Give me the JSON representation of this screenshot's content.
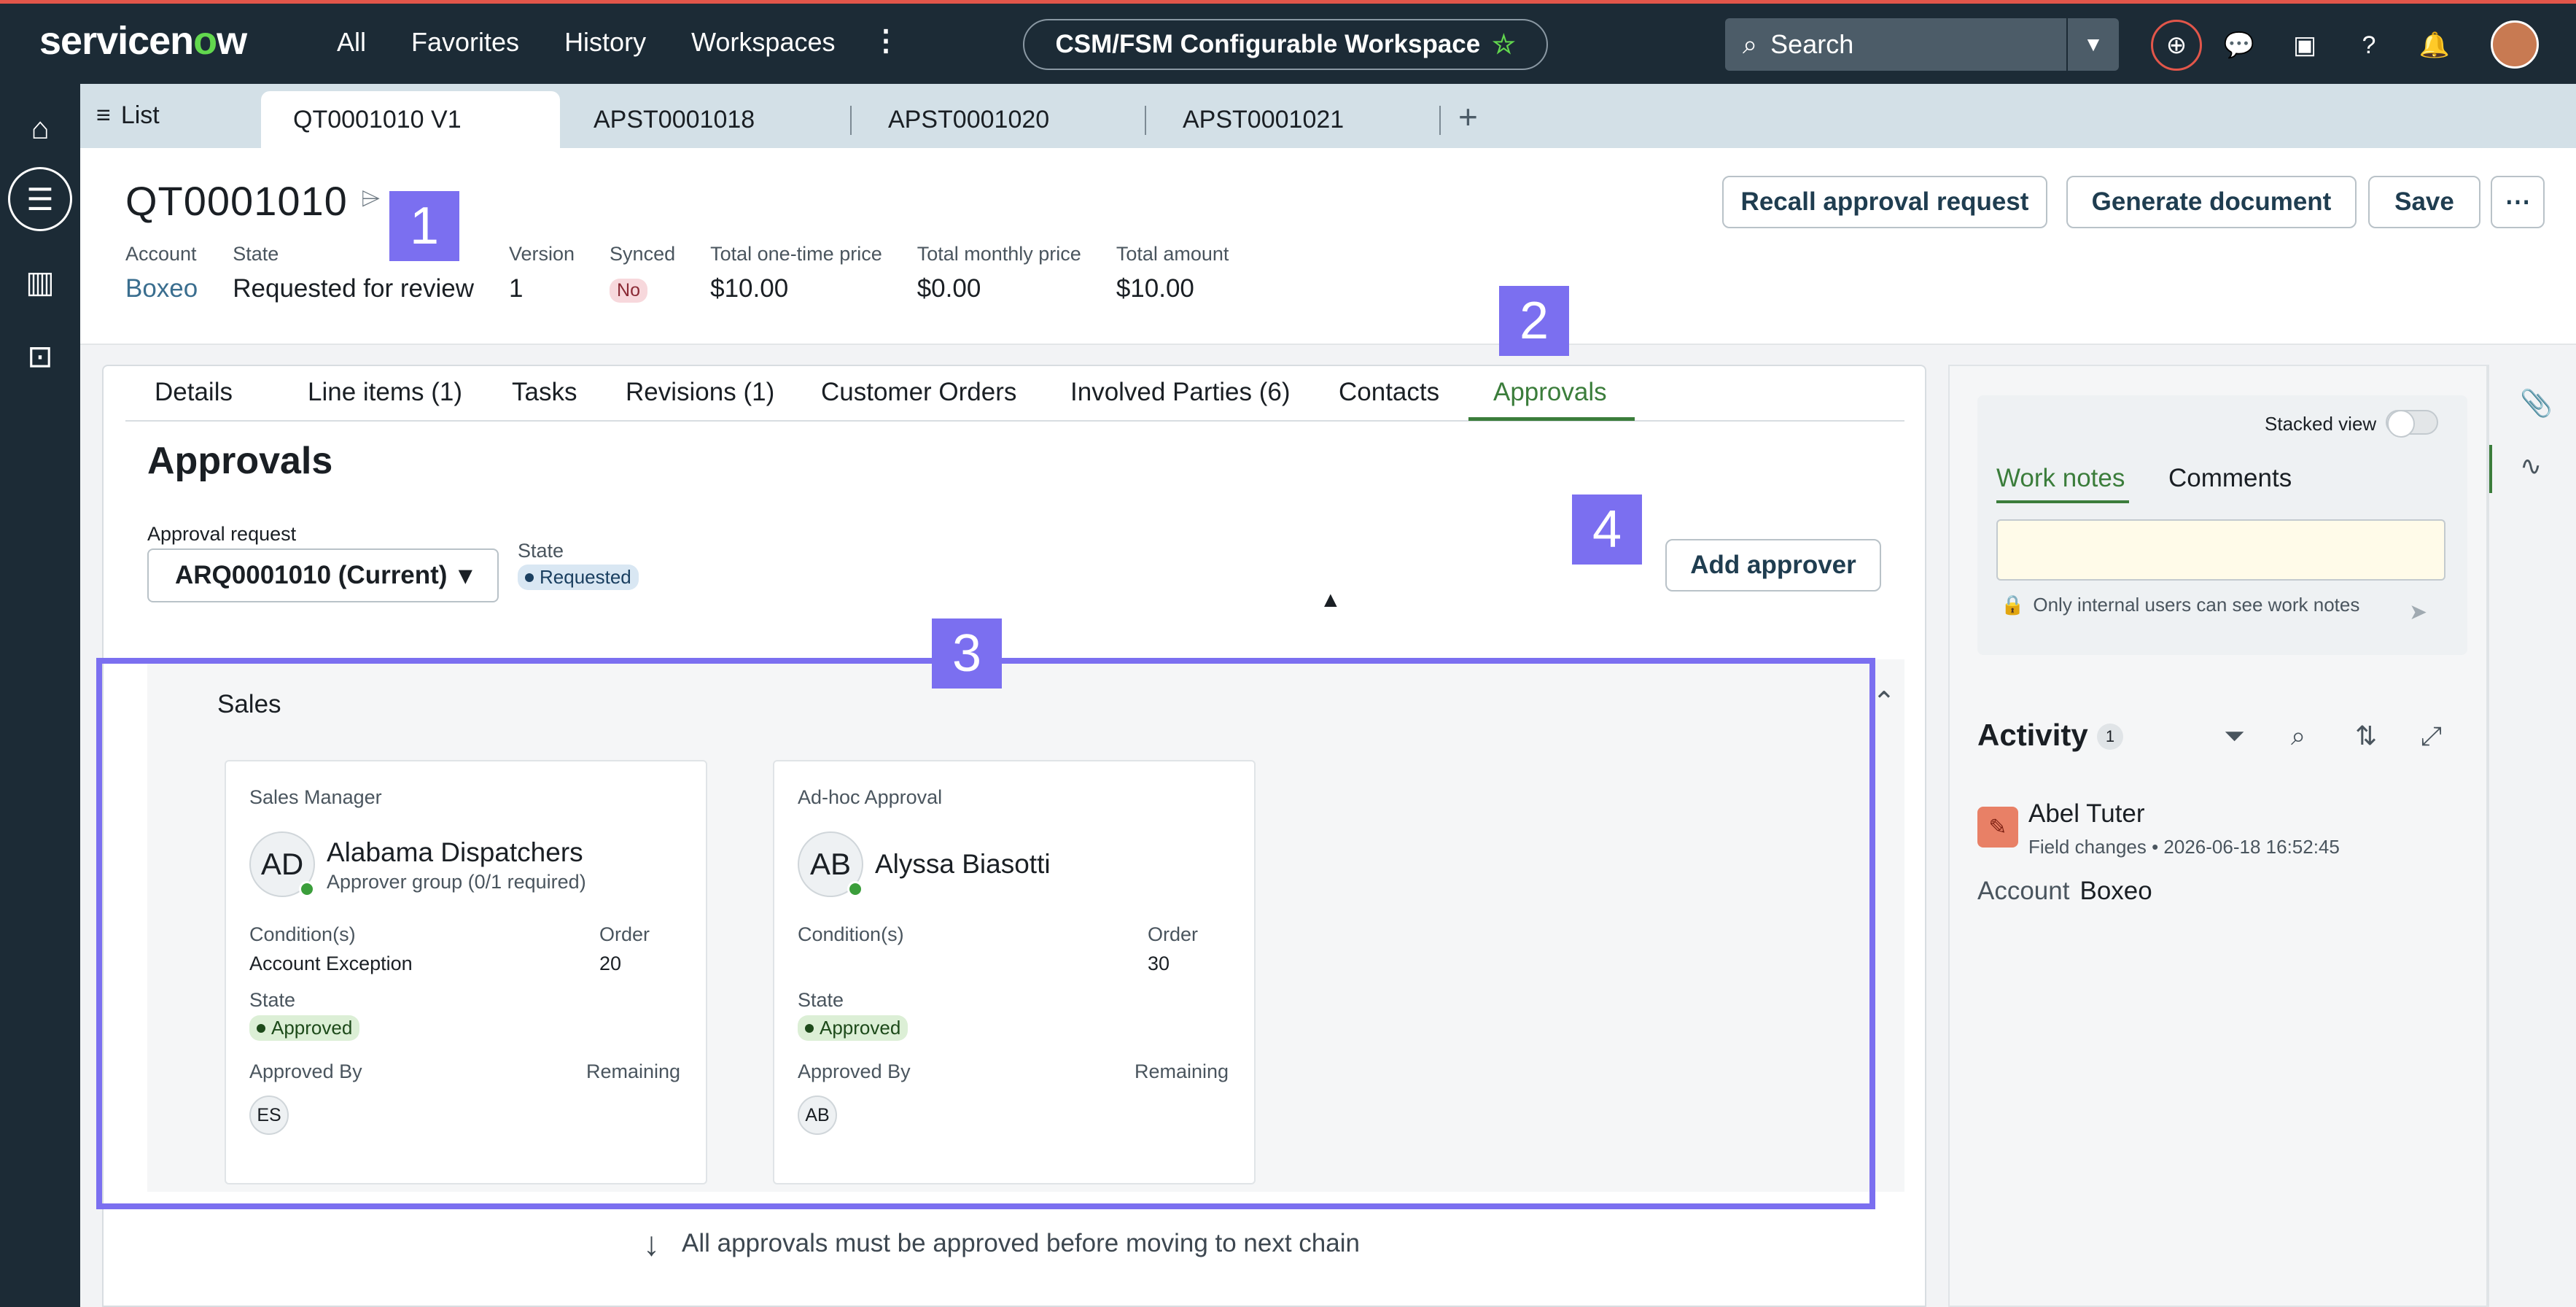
{
  "topbar": {
    "logo_main": "servicen",
    "logo_o": "o",
    "logo_tail": "w",
    "nav": [
      "All",
      "Favorites",
      "History",
      "Workspaces"
    ],
    "more_icon": "⋮",
    "workspace": "CSM/FSM Configurable Workspace",
    "search_placeholder": "Search",
    "icons": [
      "globe-icon",
      "chat-icon",
      "screen-icon",
      "help-icon",
      "bell-icon",
      "avatar"
    ]
  },
  "tabstrip": {
    "list_label": "List",
    "tabs": [
      "QT0001010 V1",
      "APST0001018",
      "APST0001020",
      "APST0001021"
    ],
    "plus": "+",
    "more": "⋯"
  },
  "record": {
    "title": "QT0001010",
    "fields": [
      {
        "label": "Account",
        "value": "Boxeo"
      },
      {
        "label": "State",
        "value": "Requested for review"
      },
      {
        "label": "Version",
        "value": "1"
      },
      {
        "label": "Synced",
        "value": "No"
      },
      {
        "label": "Total one-time price",
        "value": "$10.00"
      },
      {
        "label": "Total monthly price",
        "value": "$0.00"
      },
      {
        "label": "Total amount",
        "value": "$10.00"
      }
    ],
    "buttons": {
      "recall": "Recall approval request",
      "generate": "Generate document",
      "save": "Save",
      "more": "⋯"
    }
  },
  "subtabs": [
    "Details",
    "Line items (1)",
    "Tasks",
    "Revisions (1)",
    "Customer Orders",
    "Involved Parties (6)",
    "Contacts",
    "Approvals"
  ],
  "approvals": {
    "title": "Approvals",
    "request_label": "Approval request",
    "request_value": "ARQ0001010 (Current)",
    "state_label": "State",
    "state_value": "Requested",
    "add_approver": "Add approver",
    "group": {
      "name": "Sales",
      "cards": [
        {
          "role": "Sales Manager",
          "initials": "AD",
          "name": "Alabama Dispatchers",
          "sub": "Approver group (0/1 required)",
          "conditions_label": "Condition(s)",
          "conditions": "Account Exception",
          "order_label": "Order",
          "order": "20",
          "state_label": "State",
          "state": "Approved",
          "approved_by_label": "Approved By",
          "approved_by": "ES",
          "remaining_label": "Remaining"
        },
        {
          "role": "Ad-hoc Approval",
          "initials": "AB",
          "name": "Alyssa Biasotti",
          "sub": "",
          "conditions_label": "Condition(s)",
          "conditions": "",
          "order_label": "Order",
          "order": "30",
          "state_label": "State",
          "state": "Approved",
          "approved_by_label": "Approved By",
          "approved_by": "AB",
          "remaining_label": "Remaining"
        }
      ]
    },
    "chain_note": "All approvals must be approved before moving to next chain"
  },
  "sidepanel": {
    "stacked_view": "Stacked view",
    "tabs": [
      "Work notes",
      "Comments"
    ],
    "hint": "Only internal users can see work notes",
    "activity_title": "Activity",
    "activity_count": "1",
    "entry": {
      "name": "Abel Tuter",
      "meta": "Field changes • 2026-06-18 16:52:45",
      "field_label": "Account",
      "field_value": "Boxeo"
    }
  },
  "annotations": [
    "1",
    "2",
    "3",
    "4"
  ],
  "colors": {
    "topbar": "#1c2b36",
    "accent_green": "#3b7d3b",
    "annotation": "#7b6ff0",
    "link": "#3a6e8f"
  }
}
